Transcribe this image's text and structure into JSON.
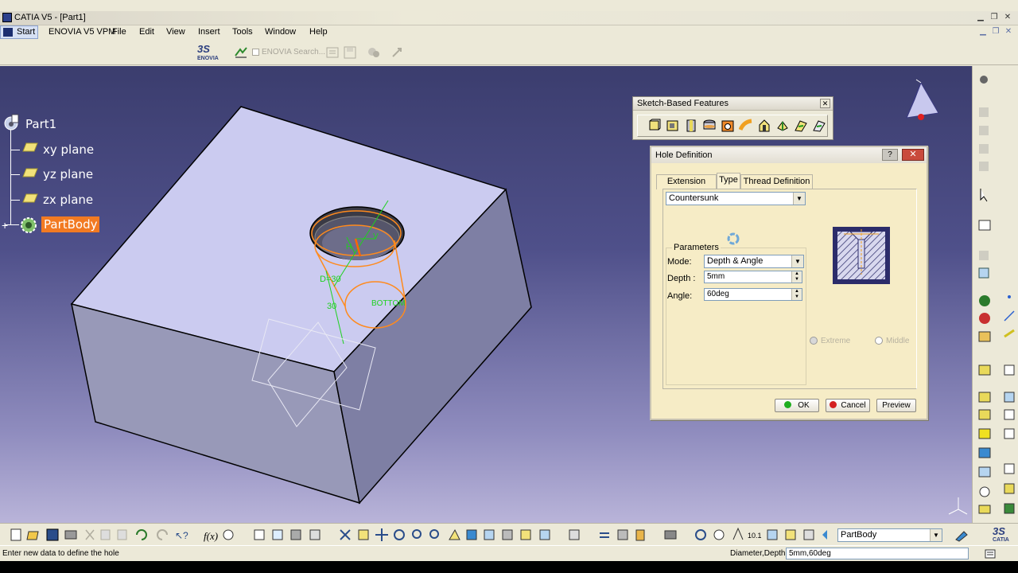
{
  "window": {
    "title": "CATIA V5 - [Part1]"
  },
  "menu": {
    "start": "Start",
    "items": [
      "ENOVIA V5 VPM",
      "File",
      "Edit",
      "View",
      "Insert",
      "Tools",
      "Window",
      "Help"
    ]
  },
  "toolbar_top": {
    "enovia_logo": "ENOVIA",
    "search_placeholder": "ENOVIA Search..."
  },
  "tree": {
    "root": "Part1",
    "items": [
      "xy plane",
      "yz plane",
      "zx plane"
    ],
    "body": "PartBody"
  },
  "geometry_labels": {
    "diameter": "D=30",
    "depth": "30",
    "bottom": "BOTTOM",
    "h": "H",
    "v": "V"
  },
  "sketch_toolbar": {
    "title": "Sketch-Based Features"
  },
  "hole_dialog": {
    "title": "Hole Definition",
    "tabs": [
      "Extension",
      "Type",
      "Thread Definition"
    ],
    "active_tab": "Type",
    "type_value": "Countersunk",
    "parameters_title": "Parameters",
    "mode_label": "Mode:",
    "mode_value": "Depth & Angle",
    "depth_label": "Depth :",
    "depth_value": "5mm",
    "angle_label": "Angle:",
    "angle_value": "60deg",
    "anchor_extreme": "Extreme",
    "anchor_middle": "Middle",
    "ok": "OK",
    "cancel": "Cancel",
    "preview": "Preview"
  },
  "bottom": {
    "current_body": "PartBody"
  },
  "status": {
    "message": "Enter new data to define the hole",
    "param_label": "Diameter,Depth",
    "param_value": "5mm,60deg"
  }
}
